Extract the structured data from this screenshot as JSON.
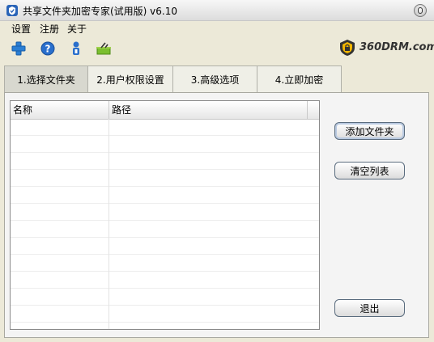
{
  "window": {
    "title": "共享文件夹加密专家(试用版) v6.10"
  },
  "menu": {
    "items": [
      "设置",
      "注册",
      "关于"
    ]
  },
  "toolbar": {
    "buttons": [
      {
        "icon": "plus-icon"
      },
      {
        "icon": "help-icon"
      },
      {
        "icon": "user-icon"
      },
      {
        "icon": "basket-icon"
      }
    ]
  },
  "logo": {
    "text": "360DRM.com"
  },
  "tabs": [
    {
      "label": "1.选择文件夹",
      "active": true
    },
    {
      "label": "2.用户权限设置",
      "active": false
    },
    {
      "label": "3.高级选项",
      "active": false
    },
    {
      "label": "4.立即加密",
      "active": false
    }
  ],
  "table": {
    "columns": [
      "名称",
      "路径"
    ],
    "rows": []
  },
  "actions": {
    "add_folder": "添加文件夹",
    "clear_list": "清空列表",
    "exit": "退出"
  },
  "colors": {
    "accent": "#1b5fb5",
    "background": "#ece9d8"
  }
}
